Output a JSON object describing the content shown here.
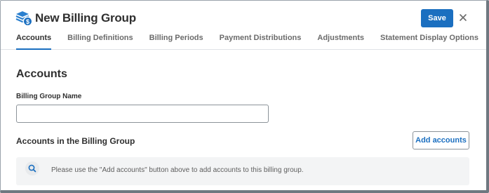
{
  "window": {
    "title": "New Billing Group",
    "icons": {
      "logo": "billing-group-dollar-icon",
      "close": "close-icon",
      "search": "search-icon"
    }
  },
  "toolbar": {
    "save_label": "Save"
  },
  "tabs": [
    {
      "label": "Accounts",
      "active": true
    },
    {
      "label": "Billing Definitions",
      "active": false
    },
    {
      "label": "Billing Periods",
      "active": false
    },
    {
      "label": "Payment Distributions",
      "active": false
    },
    {
      "label": "Adjustments",
      "active": false
    },
    {
      "label": "Statement Display Options",
      "active": false
    }
  ],
  "accounts_section": {
    "heading": "Accounts",
    "group_name_label": "Billing Group Name",
    "group_name_value": "",
    "accounts_list_heading": "Accounts in the Billing Group",
    "add_accounts_label": "Add accounts",
    "empty_message": "Please use the \"Add accounts\" button above to add accounts to this billing group."
  },
  "colors": {
    "accent": "#1b6fc0",
    "info_background": "#f3f4f5"
  }
}
